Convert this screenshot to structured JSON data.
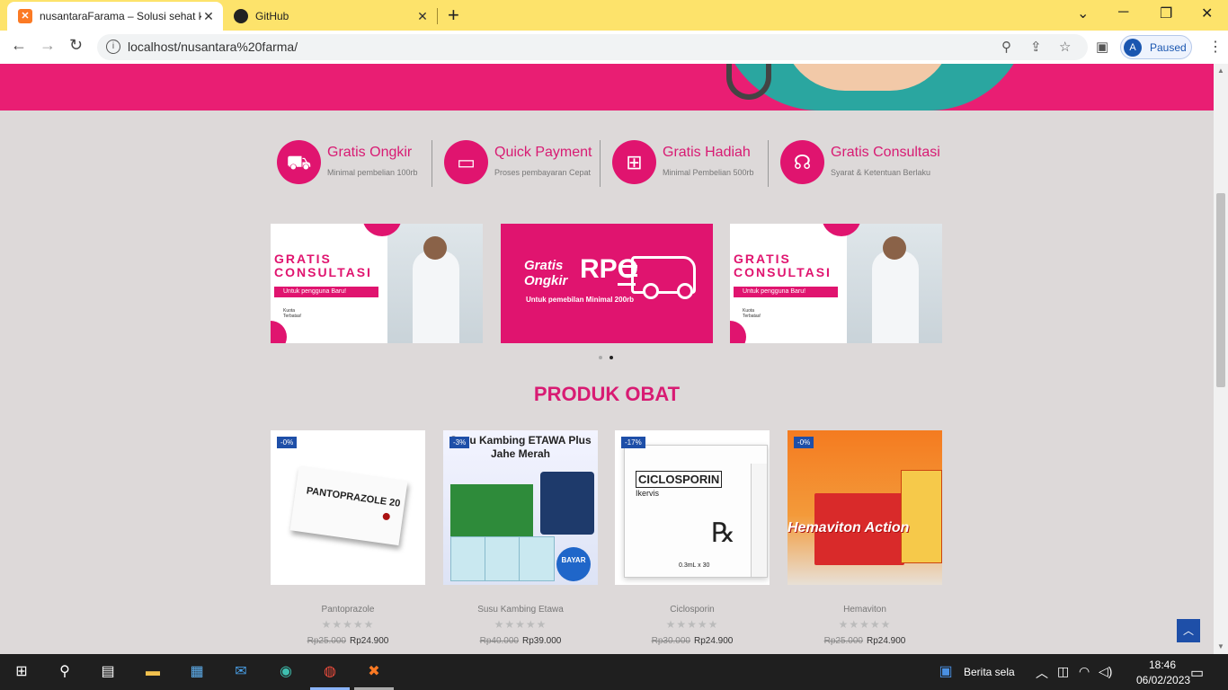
{
  "browser": {
    "tabs": [
      {
        "title": "nusantaraFarama – Solusi sehat k",
        "favicon": "xampp-icon",
        "active": true
      },
      {
        "title": "GitHub",
        "favicon": "github-icon",
        "active": false
      }
    ],
    "url": "localhost/nusantara%20farma/",
    "profile_initial": "A",
    "profile_status": "Paused"
  },
  "features": [
    {
      "title": "Gratis Ongkir",
      "subtitle": "Minimal pembelian 100rb",
      "icon": "truck-icon"
    },
    {
      "title": "Quick Payment",
      "subtitle": "Proses pembayaran Cepat",
      "icon": "card-icon"
    },
    {
      "title": "Gratis Hadiah",
      "subtitle": "Minimal Pembelian 500rb",
      "icon": "gift-icon"
    },
    {
      "title": "Gratis Consultasi",
      "subtitle": "Syarat & Ketentuan Berlaku",
      "icon": "headset-icon"
    }
  ],
  "banners": {
    "consult": {
      "title_line1": "GRATIS",
      "title_line2": "CONSULTASI",
      "ribbon": "Untuk pengguna Baru!",
      "fine_line1": "Kuota",
      "fine_line2": "Terbatas!"
    },
    "ongkir": {
      "title_line1": "Gratis",
      "title_line2": "Ongkir",
      "amount": "RPO",
      "subtitle": "Untuk pemebilan Minimal 200rb"
    }
  },
  "section_title": "PRODUK OBAT",
  "products": [
    {
      "name": "Pantoprazole",
      "badge": "-0%",
      "old_price": "Rp25.000",
      "price": "Rp24.900",
      "image_label": "PANTOPRAZOLE 20",
      "rating": 0
    },
    {
      "name": "Susu Kambing Etawa",
      "badge": "-3%",
      "old_price": "Rp40.000",
      "price": "Rp39.000",
      "image_label": "Susu Kambing ETAWA Plus Jahe Merah",
      "rating": 0
    },
    {
      "name": "Ciclosporin",
      "badge": "-17%",
      "old_price": "Rp30.000",
      "price": "Rp24.900",
      "image_label": "CICLOSPORIN",
      "rating": 0
    },
    {
      "name": "Hemaviton",
      "badge": "-0%",
      "old_price": "Rp25.000",
      "price": "Rp24.900",
      "image_label": "Hemaviton Action",
      "rating": 0
    }
  ],
  "taskbar": {
    "weather": "Berita sela",
    "time": "18:46",
    "date": "06/02/2023"
  }
}
